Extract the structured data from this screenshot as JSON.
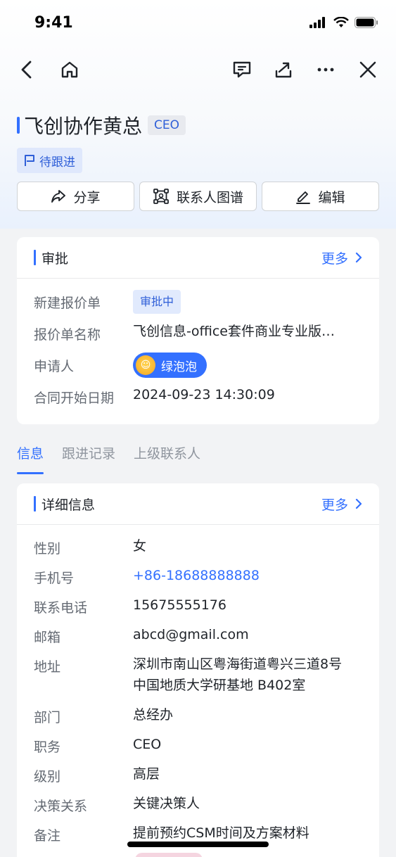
{
  "status_bar": {
    "time": "9:41"
  },
  "header": {
    "title": "飞创协作黄总",
    "badge": "CEO",
    "status_tag": "待跟进"
  },
  "actions": [
    {
      "label": "分享",
      "icon": "share-icon"
    },
    {
      "label": "联系人图谱",
      "icon": "graph-icon"
    },
    {
      "label": "编辑",
      "icon": "edit-icon"
    }
  ],
  "approval_card": {
    "title": "审批",
    "more": "更多",
    "rows": [
      {
        "label": "新建报价单",
        "value": "审批中"
      },
      {
        "label": "报价单名称",
        "value": "飞创信息-office套件商业专业版…"
      },
      {
        "label": "申请人",
        "value": "绿泡泡"
      },
      {
        "label": "合同开始日期",
        "value": "2024-09-23 14:30:09"
      }
    ]
  },
  "tabs": [
    {
      "label": "信息",
      "active": true
    },
    {
      "label": "跟进记录",
      "active": false
    },
    {
      "label": "上级联系人",
      "active": false
    }
  ],
  "detail_card": {
    "title": "详细信息",
    "more": "更多",
    "rows": [
      {
        "label": "性别",
        "value": "女"
      },
      {
        "label": "手机号",
        "value": "+86-18688888888"
      },
      {
        "label": "联系电话",
        "value": "15675555176"
      },
      {
        "label": "邮箱",
        "value": "abcd@gmail.com"
      },
      {
        "label": "地址",
        "value": "深圳市南山区粤海街道粤兴三道8号中国地质大学研基地 B402室"
      },
      {
        "label": "部门",
        "value": "总经办"
      },
      {
        "label": "职务",
        "value": "CEO"
      },
      {
        "label": "级别",
        "value": "高层"
      },
      {
        "label": "决策关系",
        "value": "关键决策人"
      },
      {
        "label": "备注",
        "value": "提前预约CSM时间及方案材料"
      }
    ]
  },
  "colors": {
    "accent": "#3370ff",
    "text_primary": "#1f2329",
    "text_secondary": "#646a73"
  }
}
